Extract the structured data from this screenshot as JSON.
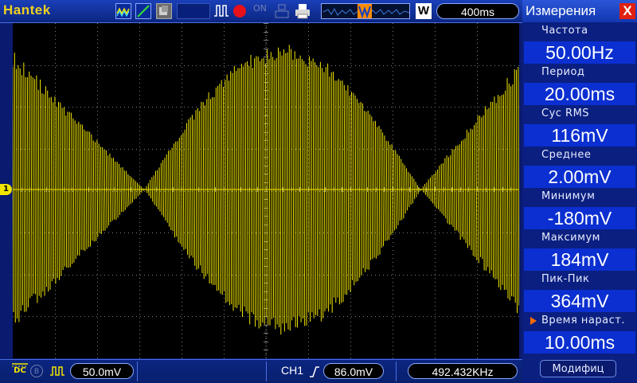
{
  "toolbar": {
    "brand": "Hantek",
    "window_badge": "W",
    "timebase": "400ms",
    "usb_label": "ON"
  },
  "trace": {
    "color": "#f2e600",
    "grid_color": "#7a7a7a",
    "ch1_marker": "1"
  },
  "status": {
    "coupling": "DC",
    "volts_div": "50.0mV",
    "trigger_source": "CH1",
    "trigger_level": "86.0mV",
    "frequency": "492.432KHz"
  },
  "measurements": {
    "title": "Измерения",
    "close_label": "X",
    "items": [
      {
        "label": "Частота",
        "value": "50.00Hz"
      },
      {
        "label": "Период",
        "value": "20.00ms"
      },
      {
        "label": "Cyc RMS",
        "value": "116mV"
      },
      {
        "label": "Среднее",
        "value": "2.00mV"
      },
      {
        "label": "Минимум",
        "value": "-180mV"
      },
      {
        "label": "Максимум",
        "value": "184mV"
      },
      {
        "label": "Пик-Пик",
        "value": "364mV"
      },
      {
        "label": "Время нараст.",
        "value": "10.00ms"
      }
    ],
    "modify_label": "Модифиц"
  }
}
